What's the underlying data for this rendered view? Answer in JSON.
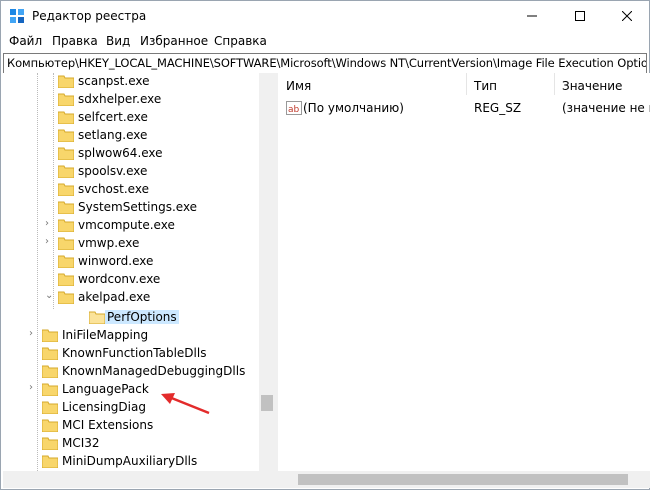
{
  "window": {
    "title": "Редактор реестра"
  },
  "menu": [
    "Файл",
    "Правка",
    "Вид",
    "Избранное",
    "Справка"
  ],
  "address": "Компьютер\\HKEY_LOCAL_MACHINE\\SOFTWARE\\Microsoft\\Windows NT\\CurrentVersion\\Image File Execution Options\\a",
  "tree": [
    "scanpst.exe",
    "sdxhelper.exe",
    "selfcert.exe",
    "setlang.exe",
    "splwow64.exe",
    "spoolsv.exe",
    "svchost.exe",
    "SystemSettings.exe",
    "vmcompute.exe",
    "vmwp.exe",
    "winword.exe",
    "wordconv.exe",
    "akelpad.exe",
    "PerfOptions",
    "IniFileMapping",
    "KnownFunctionTableDlls",
    "KnownManagedDebuggingDlls",
    "LanguagePack",
    "LicensingDiag",
    "MCI Extensions",
    "MCI32",
    "MiniDumpAuxiliaryDlls"
  ],
  "list": {
    "headers": [
      "Имя",
      "Тип",
      "Значение"
    ],
    "rows": [
      {
        "name": "(По умолчанию)",
        "type": "REG_SZ",
        "value": "(значение не пр"
      }
    ]
  },
  "colors": {
    "selection": "#cce8ff",
    "folder": "#f8d66b",
    "arrow": "#e32b2b"
  }
}
